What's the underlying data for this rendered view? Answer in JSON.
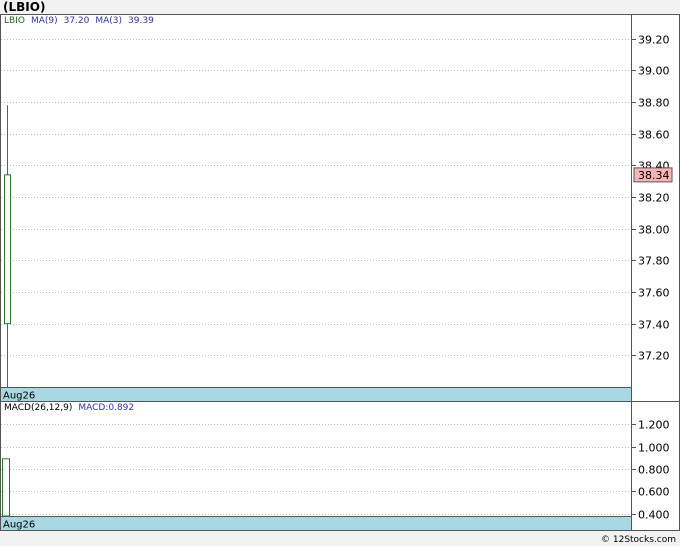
{
  "title": "(LBIO)",
  "watermark": "© 12Stocks.com",
  "colors": {
    "grid": "#bbbbbb",
    "frame": "#555555",
    "up_candle": "#2e7d32",
    "legend_symbol": "#1f6b1f",
    "legend_ma": "#3333aa",
    "date_band": "#a8d8e2",
    "price_badge_bg": "#f6b4b4"
  },
  "price_panel": {
    "legend": {
      "symbol": "LBIO",
      "ma9_label": "MA(9)",
      "ma9_value": "37.20",
      "ma3_label": "MA(3)",
      "ma3_value": "39.39"
    },
    "date_label": "Aug26",
    "current_price_label": "38.34"
  },
  "macd_panel": {
    "legend": {
      "label": "MACD(26,12,9)",
      "value_text": "MACD:0.892"
    },
    "date_label": "Aug26"
  },
  "chart_data": [
    {
      "type": "candlestick",
      "title": "(LBIO)",
      "x": [
        "Aug26"
      ],
      "ylim": [
        37.0,
        39.35
      ],
      "yticks": [
        37.2,
        37.4,
        37.6,
        37.8,
        38.0,
        38.2,
        38.4,
        38.6,
        38.8,
        39.0,
        39.2
      ],
      "ytick_labels": [
        "37.20",
        "37.40",
        "37.60",
        "37.80",
        "38.00",
        "38.20",
        "38.40",
        "38.60",
        "38.80",
        "39.00",
        "39.20"
      ],
      "grid": true,
      "candles": [
        {
          "date": "Aug26",
          "open": 37.4,
          "close": 38.34,
          "high": 38.78,
          "low": 37.0,
          "direction": "up"
        }
      ],
      "current_price": 38.34
    },
    {
      "type": "bar",
      "title": "MACD(26,12,9)",
      "x": [
        "Aug26"
      ],
      "ylim": [
        0.38,
        1.4
      ],
      "yticks": [
        0.4,
        0.6,
        0.8,
        1.0,
        1.2
      ],
      "ytick_labels": [
        "0.400",
        "0.600",
        "0.800",
        "1.000",
        "1.200"
      ],
      "grid": true,
      "values": [
        0.892
      ]
    }
  ]
}
